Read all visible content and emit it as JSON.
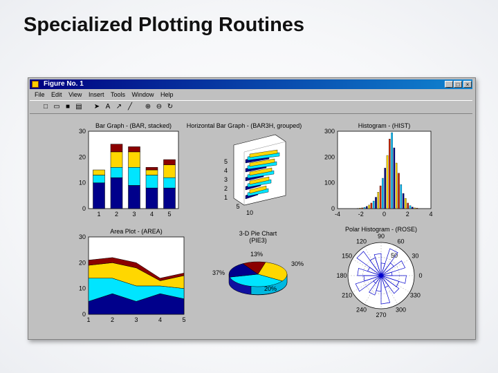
{
  "slide": {
    "title": "Specialized Plotting Routines"
  },
  "window": {
    "title": "Figure No. 1",
    "menu": [
      "File",
      "Edit",
      "View",
      "Insert",
      "Tools",
      "Window",
      "Help"
    ],
    "controls": [
      "_",
      "□",
      "×"
    ],
    "toolbar": [
      "new-icon",
      "open-icon",
      "save-icon",
      "print-icon",
      "arrow-icon",
      "text-icon",
      "arrow-tool-icon",
      "line-icon",
      "zoom-in-icon",
      "zoom-out-icon",
      "rotate-icon"
    ]
  },
  "colors": {
    "navy": "#00008b",
    "cyan": "#00e5ff",
    "yellow": "#ffd700",
    "maroon": "#8b0000",
    "red": "#cc2200"
  },
  "chart_data": [
    {
      "id": "bar",
      "type": "bar",
      "title": "Bar Graph - (BAR, stacked)",
      "categories": [
        "1",
        "2",
        "3",
        "4",
        "5"
      ],
      "series": [
        {
          "values": [
            10,
            12,
            9,
            8,
            8
          ]
        },
        {
          "values": [
            3,
            4,
            7,
            5,
            4
          ]
        },
        {
          "values": [
            2,
            6,
            6,
            2,
            5
          ]
        },
        {
          "values": [
            0,
            3,
            2,
            1,
            2
          ]
        }
      ],
      "ylim": [
        0,
        30
      ],
      "yticks": [
        "0",
        "10",
        "20",
        "30"
      ]
    },
    {
      "id": "barh",
      "type": "bar",
      "title": "Horizontal Bar Graph - (BAR3H, grouped)",
      "yticks": [
        "1",
        "2",
        "3",
        "4",
        "5"
      ],
      "xticks": [
        "5",
        "10"
      ]
    },
    {
      "id": "hist",
      "type": "bar",
      "title": "Histogram - (HIST)",
      "xticks": [
        "-4",
        "-2",
        "0",
        "2",
        "4"
      ],
      "yticks": [
        "0",
        "100",
        "200",
        "300"
      ],
      "ylim": [
        0,
        300
      ]
    },
    {
      "id": "area",
      "type": "area",
      "title": "Area Plot - (AREA)",
      "x": [
        1,
        2,
        3,
        4,
        5
      ],
      "series": [
        {
          "values": [
            5,
            8,
            5,
            8,
            6
          ]
        },
        {
          "values": [
            9,
            6,
            6,
            3,
            4
          ]
        },
        {
          "values": [
            5,
            6,
            7,
            2,
            5
          ]
        },
        {
          "values": [
            2,
            2,
            2,
            1,
            1
          ]
        }
      ],
      "xticks": [
        "1",
        "2",
        "3",
        "4",
        "5"
      ],
      "yticks": [
        "0",
        "10",
        "20",
        "30"
      ],
      "ylim": [
        0,
        30
      ]
    },
    {
      "id": "pie",
      "type": "pie",
      "title": "3-D Pie Chart",
      "subtitle": "(PIE3)",
      "labels": [
        "13%",
        "30%",
        "37%",
        "20%"
      ],
      "values": [
        13,
        30,
        37,
        20
      ]
    },
    {
      "id": "polar",
      "type": "scatter",
      "title": "Polar Histogram - (ROSE)",
      "angle_ticks": [
        "90",
        "60",
        "30",
        "0",
        "330",
        "300",
        "270",
        "240",
        "210",
        "180",
        "150",
        "120"
      ],
      "radial_tick": "50"
    }
  ]
}
